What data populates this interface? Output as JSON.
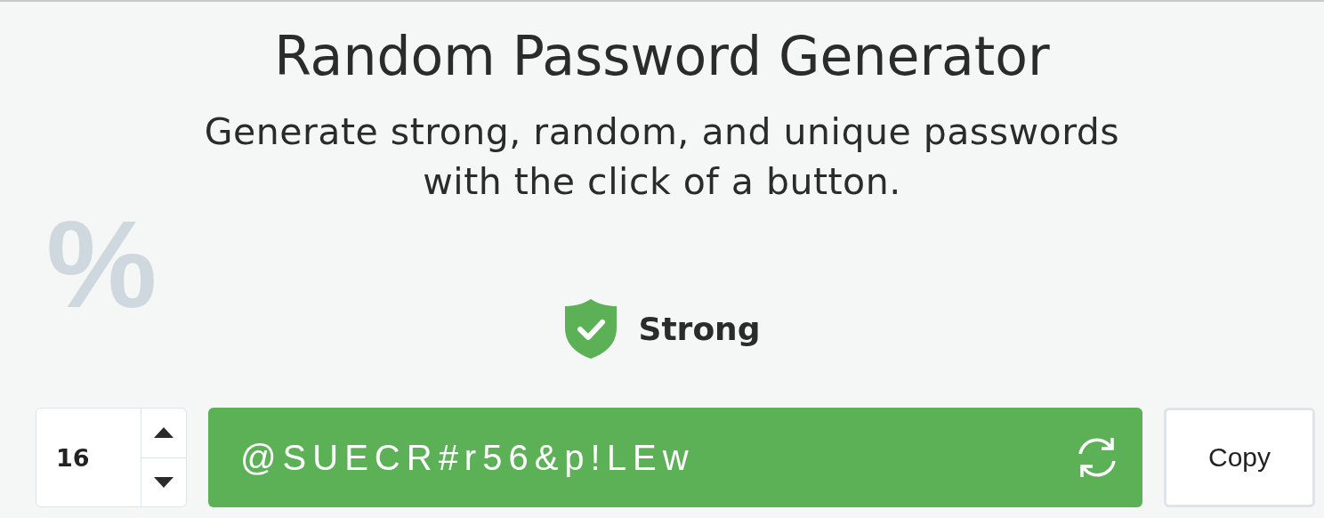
{
  "title": "Random Password Generator",
  "subtitle": [
    "Generate strong, random, and unique passwords",
    "with the click of a button."
  ],
  "background_glyph": "%",
  "strength": {
    "label": "Strong",
    "kind": "strong"
  },
  "length_field": {
    "value": "16"
  },
  "password": {
    "value": "@SUECR#r56&p!LEw"
  },
  "copy_button": {
    "label": "Copy"
  }
}
